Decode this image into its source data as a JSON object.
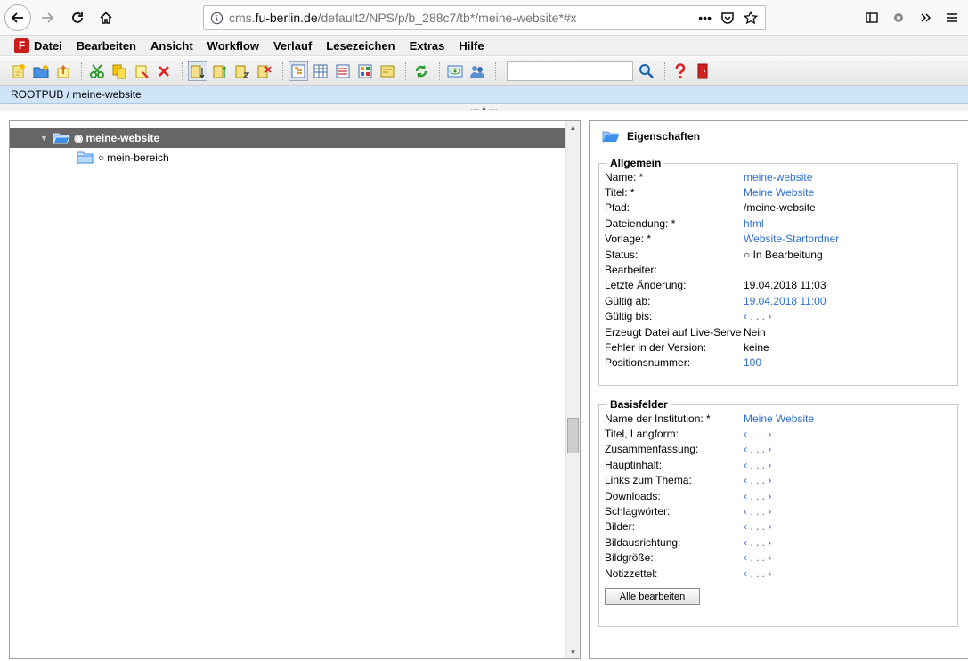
{
  "browser": {
    "url_prefix": "cms.",
    "url_host": "fu-berlin.de",
    "url_path": "/default2/NPS/p/b_288c7/tb*/meine-website*#x",
    "url_more": "•••"
  },
  "menu": [
    "Datei",
    "Bearbeiten",
    "Ansicht",
    "Workflow",
    "Verlauf",
    "Lesezeichen",
    "Extras",
    "Hilfe"
  ],
  "toolbar": {
    "search_value": ""
  },
  "breadcrumb": "ROOTPUB / meine-website",
  "splitter": "..... ▲ .....",
  "tree": {
    "root": {
      "label": "meine-website",
      "bullet": "◉"
    },
    "child": {
      "label": "mein-bereich",
      "bullet": "○"
    }
  },
  "properties": {
    "title": "Eigenschaften",
    "general": {
      "legend": "Allgemein",
      "rows": [
        {
          "label": "Name: *",
          "value": "meine-website",
          "link": true
        },
        {
          "label": "Titel: *",
          "value": "Meine Website",
          "link": true
        },
        {
          "label": "Pfad:",
          "value": "/meine-website",
          "link": false
        },
        {
          "label": "Dateiendung: *",
          "value": "html",
          "link": true
        },
        {
          "label": "Vorlage: *",
          "value": "Website-Startordner",
          "link": true
        },
        {
          "label": "Status:",
          "value": "○ In Bearbeitung",
          "link": false
        },
        {
          "label": "Bearbeiter:",
          "value": "",
          "link": false
        },
        {
          "label": "Letzte Änderung:",
          "value": "19.04.2018 11:03",
          "link": false
        },
        {
          "label": "Gültig ab:",
          "value": "19.04.2018 11:00",
          "link": true
        },
        {
          "label": "Gültig bis:",
          "value": "‹ . . . ›",
          "link": true
        },
        {
          "label": "Erzeugt Datei auf Live-Serve",
          "value": "Nein",
          "link": false
        },
        {
          "label": "Fehler in der Version:",
          "value": "keine",
          "link": false
        },
        {
          "label": "Positionsnummer:",
          "value": "100",
          "link": true
        }
      ]
    },
    "base": {
      "legend": "Basisfelder",
      "rows": [
        {
          "label": "Name der Institution: *",
          "value": "Meine Website",
          "link": true
        },
        {
          "label": "Titel, Langform:",
          "value": "‹ . . . ›",
          "link": true
        },
        {
          "label": "Zusammenfassung:",
          "value": "‹ . . . ›",
          "link": true
        },
        {
          "label": "Hauptinhalt:",
          "value": "‹ . . . ›",
          "link": true
        },
        {
          "label": "Links zum Thema:",
          "value": "‹ . . . ›",
          "link": true
        },
        {
          "label": "Downloads:",
          "value": "‹ . . . ›",
          "link": true
        },
        {
          "label": "Schlagwörter:",
          "value": "‹ . . . ›",
          "link": true
        },
        {
          "label": "Bilder:",
          "value": "‹ . . . ›",
          "link": true
        },
        {
          "label": "Bildausrichtung:",
          "value": "‹ . . . ›",
          "link": true
        },
        {
          "label": "Bildgröße:",
          "value": "‹ . . . ›",
          "link": true
        },
        {
          "label": "Notizzettel:",
          "value": "‹ . . . ›",
          "link": true
        }
      ],
      "edit_all_label": "Alle bearbeiten"
    }
  },
  "colors": {
    "link": "#2e6fd1",
    "selection": "#666666",
    "breadcrumb_bg": "#cfe4f7",
    "folder": "#3d8ee8"
  }
}
